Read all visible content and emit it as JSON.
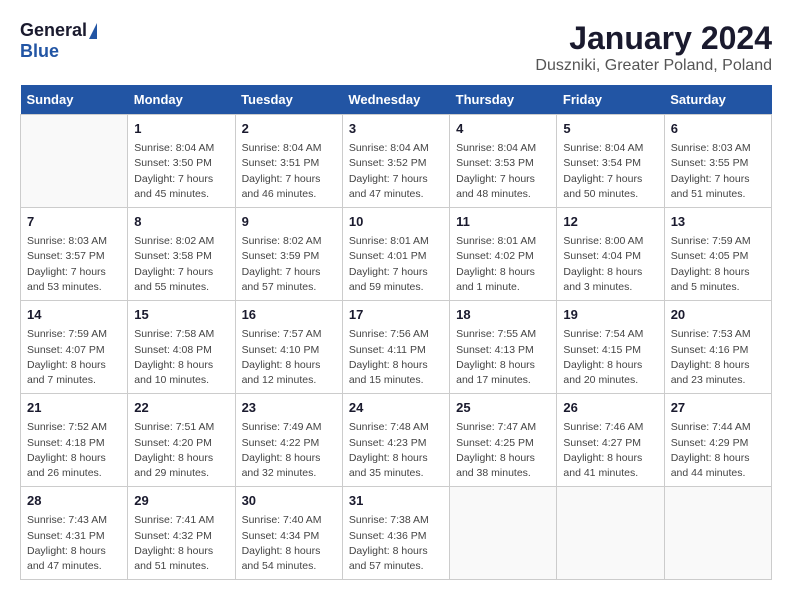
{
  "logo": {
    "general": "General",
    "blue": "Blue"
  },
  "title": "January 2024",
  "subtitle": "Duszniki, Greater Poland, Poland",
  "days_of_week": [
    "Sunday",
    "Monday",
    "Tuesday",
    "Wednesday",
    "Thursday",
    "Friday",
    "Saturday"
  ],
  "weeks": [
    [
      {
        "num": "",
        "info": ""
      },
      {
        "num": "1",
        "info": "Sunrise: 8:04 AM\nSunset: 3:50 PM\nDaylight: 7 hours\nand 45 minutes."
      },
      {
        "num": "2",
        "info": "Sunrise: 8:04 AM\nSunset: 3:51 PM\nDaylight: 7 hours\nand 46 minutes."
      },
      {
        "num": "3",
        "info": "Sunrise: 8:04 AM\nSunset: 3:52 PM\nDaylight: 7 hours\nand 47 minutes."
      },
      {
        "num": "4",
        "info": "Sunrise: 8:04 AM\nSunset: 3:53 PM\nDaylight: 7 hours\nand 48 minutes."
      },
      {
        "num": "5",
        "info": "Sunrise: 8:04 AM\nSunset: 3:54 PM\nDaylight: 7 hours\nand 50 minutes."
      },
      {
        "num": "6",
        "info": "Sunrise: 8:03 AM\nSunset: 3:55 PM\nDaylight: 7 hours\nand 51 minutes."
      }
    ],
    [
      {
        "num": "7",
        "info": "Sunrise: 8:03 AM\nSunset: 3:57 PM\nDaylight: 7 hours\nand 53 minutes."
      },
      {
        "num": "8",
        "info": "Sunrise: 8:02 AM\nSunset: 3:58 PM\nDaylight: 7 hours\nand 55 minutes."
      },
      {
        "num": "9",
        "info": "Sunrise: 8:02 AM\nSunset: 3:59 PM\nDaylight: 7 hours\nand 57 minutes."
      },
      {
        "num": "10",
        "info": "Sunrise: 8:01 AM\nSunset: 4:01 PM\nDaylight: 7 hours\nand 59 minutes."
      },
      {
        "num": "11",
        "info": "Sunrise: 8:01 AM\nSunset: 4:02 PM\nDaylight: 8 hours\nand 1 minute."
      },
      {
        "num": "12",
        "info": "Sunrise: 8:00 AM\nSunset: 4:04 PM\nDaylight: 8 hours\nand 3 minutes."
      },
      {
        "num": "13",
        "info": "Sunrise: 7:59 AM\nSunset: 4:05 PM\nDaylight: 8 hours\nand 5 minutes."
      }
    ],
    [
      {
        "num": "14",
        "info": "Sunrise: 7:59 AM\nSunset: 4:07 PM\nDaylight: 8 hours\nand 7 minutes."
      },
      {
        "num": "15",
        "info": "Sunrise: 7:58 AM\nSunset: 4:08 PM\nDaylight: 8 hours\nand 10 minutes."
      },
      {
        "num": "16",
        "info": "Sunrise: 7:57 AM\nSunset: 4:10 PM\nDaylight: 8 hours\nand 12 minutes."
      },
      {
        "num": "17",
        "info": "Sunrise: 7:56 AM\nSunset: 4:11 PM\nDaylight: 8 hours\nand 15 minutes."
      },
      {
        "num": "18",
        "info": "Sunrise: 7:55 AM\nSunset: 4:13 PM\nDaylight: 8 hours\nand 17 minutes."
      },
      {
        "num": "19",
        "info": "Sunrise: 7:54 AM\nSunset: 4:15 PM\nDaylight: 8 hours\nand 20 minutes."
      },
      {
        "num": "20",
        "info": "Sunrise: 7:53 AM\nSunset: 4:16 PM\nDaylight: 8 hours\nand 23 minutes."
      }
    ],
    [
      {
        "num": "21",
        "info": "Sunrise: 7:52 AM\nSunset: 4:18 PM\nDaylight: 8 hours\nand 26 minutes."
      },
      {
        "num": "22",
        "info": "Sunrise: 7:51 AM\nSunset: 4:20 PM\nDaylight: 8 hours\nand 29 minutes."
      },
      {
        "num": "23",
        "info": "Sunrise: 7:49 AM\nSunset: 4:22 PM\nDaylight: 8 hours\nand 32 minutes."
      },
      {
        "num": "24",
        "info": "Sunrise: 7:48 AM\nSunset: 4:23 PM\nDaylight: 8 hours\nand 35 minutes."
      },
      {
        "num": "25",
        "info": "Sunrise: 7:47 AM\nSunset: 4:25 PM\nDaylight: 8 hours\nand 38 minutes."
      },
      {
        "num": "26",
        "info": "Sunrise: 7:46 AM\nSunset: 4:27 PM\nDaylight: 8 hours\nand 41 minutes."
      },
      {
        "num": "27",
        "info": "Sunrise: 7:44 AM\nSunset: 4:29 PM\nDaylight: 8 hours\nand 44 minutes."
      }
    ],
    [
      {
        "num": "28",
        "info": "Sunrise: 7:43 AM\nSunset: 4:31 PM\nDaylight: 8 hours\nand 47 minutes."
      },
      {
        "num": "29",
        "info": "Sunrise: 7:41 AM\nSunset: 4:32 PM\nDaylight: 8 hours\nand 51 minutes."
      },
      {
        "num": "30",
        "info": "Sunrise: 7:40 AM\nSunset: 4:34 PM\nDaylight: 8 hours\nand 54 minutes."
      },
      {
        "num": "31",
        "info": "Sunrise: 7:38 AM\nSunset: 4:36 PM\nDaylight: 8 hours\nand 57 minutes."
      },
      {
        "num": "",
        "info": ""
      },
      {
        "num": "",
        "info": ""
      },
      {
        "num": "",
        "info": ""
      }
    ]
  ]
}
